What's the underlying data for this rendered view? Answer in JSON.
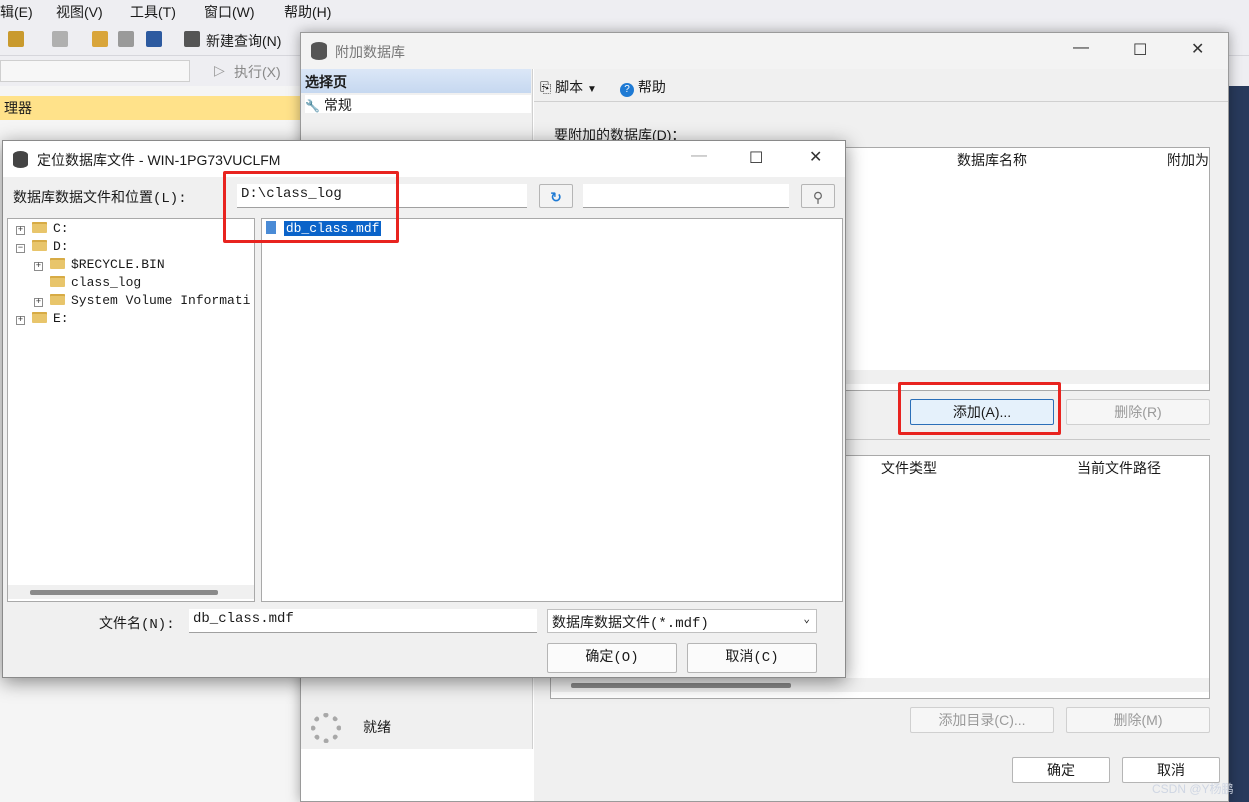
{
  "ssms": {
    "menu": [
      "辑(E)",
      "视图(V)",
      "工具(T)",
      "窗口(W)",
      "帮助(H)"
    ],
    "toolbar": {
      "new_query": "新建查询(N)",
      "execute": "执行(X)"
    },
    "obj_explorer_title": "理器"
  },
  "attach": {
    "title": "附加数据库",
    "side_header": "选择页",
    "side_item": "常规",
    "toolbar": {
      "script": "脚本",
      "help": "帮助"
    },
    "db_label": "要附加的数据库(D)：",
    "db_columns": [
      "数据库名称",
      "附加为"
    ],
    "add_button": "添加(A)...",
    "remove_button": "删除(R)",
    "details_columns": [
      "文件类型",
      "当前文件路径"
    ],
    "add_catalog_button": "添加目录(C)...",
    "remove_details_button": "删除(M)",
    "status": "就绪",
    "ok_button": "确定",
    "cancel_button": "取消"
  },
  "locate": {
    "title": "定位数据库文件 - WIN-1PG73VUCLFM",
    "path_label": "数据库数据文件和位置(L):",
    "path_value": "D:\\class_log",
    "tree": {
      "c": "C:",
      "d": "D:",
      "recycle": "$RECYCLE.BIN",
      "class_log": "class_log",
      "sysvol": "System Volume Informati",
      "e": "E:"
    },
    "files": [
      "db_class.mdf"
    ],
    "filename_label": "文件名(N):",
    "filename_value": "db_class.mdf",
    "filter_value": "数据库数据文件(*.mdf)",
    "ok_button": "确定(O)",
    "cancel_button": "取消(C)"
  },
  "watermark": "CSDN @Y杨鹏",
  "colors": {
    "highlight": "#e8231f",
    "selection": "#0a63c9"
  }
}
